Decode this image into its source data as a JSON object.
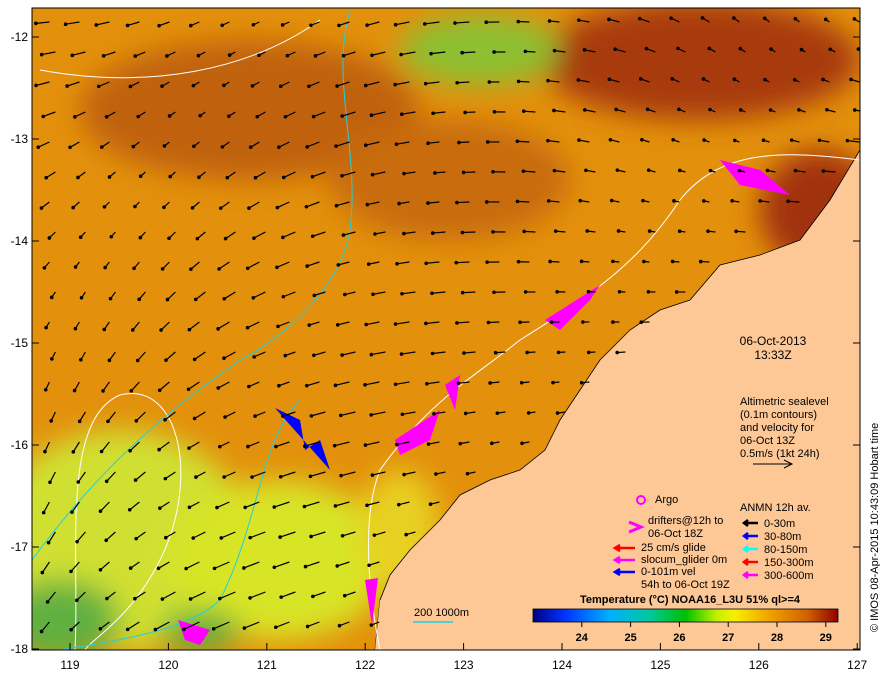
{
  "map": {
    "date": "06-Oct-2013",
    "time": "13:33Z",
    "x_ticks": [
      "119",
      "120",
      "121",
      "122",
      "123",
      "124",
      "125",
      "126",
      "127"
    ],
    "y_ticks": [
      "-12",
      "-13",
      "-14",
      "-15",
      "-16",
      "-17",
      "-18"
    ],
    "altimetry_note": [
      "Altimetric sealevel",
      "(0.1m contours)",
      "and velocity for",
      "06-Oct 13Z",
      "0.5m/s (1kt 24h)"
    ],
    "scale_bar_label": "200  1000m",
    "credit": "© IMOS 08-Apr-2015 10:43:09 Hobart time"
  },
  "legend": {
    "argo": "Argo",
    "drifters": [
      "drifters@12h to",
      "06-Oct 18Z"
    ],
    "glide": "25 cm/s glide",
    "slocum": "slocum_glider 0m",
    "vel": [
      "0-101m vel",
      "54h to 06-Oct 19Z"
    ],
    "anmn_title": "ANMN 12h av.",
    "anmn": [
      {
        "label": "0-30m",
        "color": "#000000"
      },
      {
        "label": "30-80m",
        "color": "#0000ff"
      },
      {
        "label": "80-150m",
        "color": "#00ffff"
      },
      {
        "label": "150-300m",
        "color": "#ff0000"
      },
      {
        "label": "300-600m",
        "color": "#ff00ff"
      }
    ]
  },
  "colorbar": {
    "title": "Temperature (°C) NOAA16_L3U 51% ql>=4",
    "range": [
      23.0,
      29.25
    ],
    "ticks": [
      "24",
      "25",
      "26",
      "27",
      "28",
      "29"
    ]
  }
}
